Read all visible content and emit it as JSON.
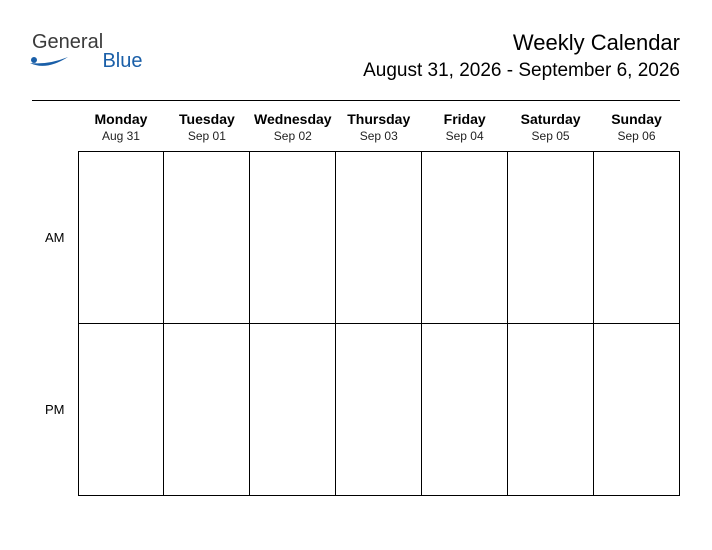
{
  "brand": {
    "word1": "General",
    "word2": "Blue"
  },
  "title": "Weekly Calendar",
  "date_range": "August 31, 2026 - September 6, 2026",
  "days": [
    {
      "name": "Monday",
      "date": "Aug 31"
    },
    {
      "name": "Tuesday",
      "date": "Sep 01"
    },
    {
      "name": "Wednesday",
      "date": "Sep 02"
    },
    {
      "name": "Thursday",
      "date": "Sep 03"
    },
    {
      "name": "Friday",
      "date": "Sep 04"
    },
    {
      "name": "Saturday",
      "date": "Sep 05"
    },
    {
      "name": "Sunday",
      "date": "Sep 06"
    }
  ],
  "periods": {
    "am": "AM",
    "pm": "PM"
  }
}
